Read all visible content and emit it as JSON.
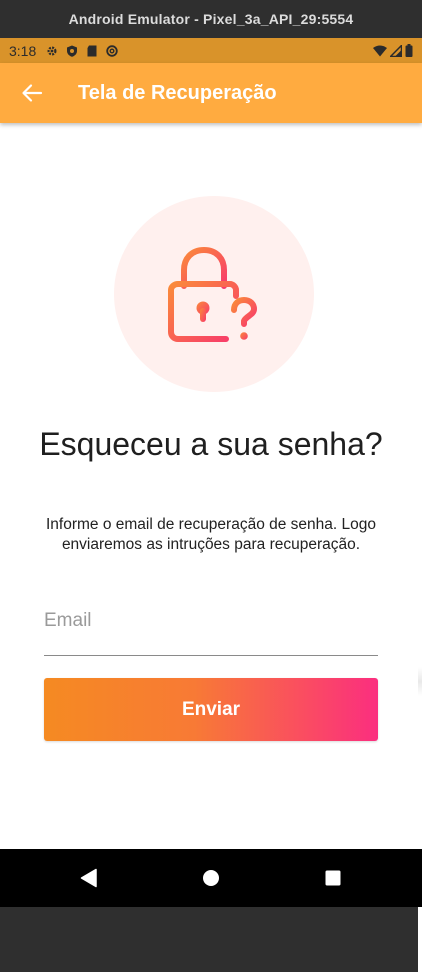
{
  "window": {
    "title": "Android Emulator - Pixel_3a_API_29:5554"
  },
  "status_bar": {
    "time": "3:18",
    "icons": [
      "gear-icon",
      "shield-icon",
      "sd-card-icon",
      "no-entry-icon"
    ],
    "right_icons": [
      "wifi-icon",
      "signal-icon",
      "battery-icon"
    ]
  },
  "app_bar": {
    "title": "Tela de Recuperação",
    "back_icon": "arrow-back-icon",
    "color": "#ffab40"
  },
  "main": {
    "illustration_icon": "lock-question-icon",
    "headline": "Esqueceu a sua senha?",
    "description": "Informe o email de recuperação de senha. Logo enviaremos as intruções para recuperação.",
    "email": {
      "placeholder": "Email",
      "value": ""
    },
    "send_button": {
      "label": "Enviar",
      "gradient": [
        "#f58a22",
        "#fb2e7f"
      ]
    }
  },
  "nav_bar": {
    "items": [
      "back-triangle-icon",
      "home-circle-icon",
      "recents-square-icon"
    ]
  }
}
